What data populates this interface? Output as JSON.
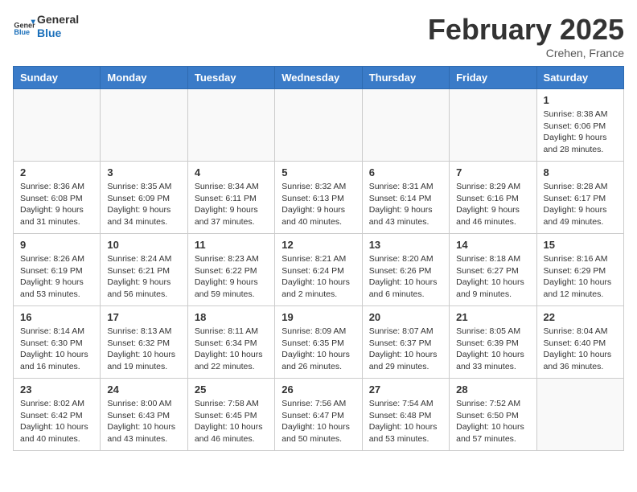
{
  "header": {
    "logo_general": "General",
    "logo_blue": "Blue",
    "month_title": "February 2025",
    "location": "Crehen, France"
  },
  "calendar": {
    "days_of_week": [
      "Sunday",
      "Monday",
      "Tuesday",
      "Wednesday",
      "Thursday",
      "Friday",
      "Saturday"
    ],
    "weeks": [
      [
        {
          "day": "",
          "info": ""
        },
        {
          "day": "",
          "info": ""
        },
        {
          "day": "",
          "info": ""
        },
        {
          "day": "",
          "info": ""
        },
        {
          "day": "",
          "info": ""
        },
        {
          "day": "",
          "info": ""
        },
        {
          "day": "1",
          "info": "Sunrise: 8:38 AM\nSunset: 6:06 PM\nDaylight: 9 hours and 28 minutes."
        }
      ],
      [
        {
          "day": "2",
          "info": "Sunrise: 8:36 AM\nSunset: 6:08 PM\nDaylight: 9 hours and 31 minutes."
        },
        {
          "day": "3",
          "info": "Sunrise: 8:35 AM\nSunset: 6:09 PM\nDaylight: 9 hours and 34 minutes."
        },
        {
          "day": "4",
          "info": "Sunrise: 8:34 AM\nSunset: 6:11 PM\nDaylight: 9 hours and 37 minutes."
        },
        {
          "day": "5",
          "info": "Sunrise: 8:32 AM\nSunset: 6:13 PM\nDaylight: 9 hours and 40 minutes."
        },
        {
          "day": "6",
          "info": "Sunrise: 8:31 AM\nSunset: 6:14 PM\nDaylight: 9 hours and 43 minutes."
        },
        {
          "day": "7",
          "info": "Sunrise: 8:29 AM\nSunset: 6:16 PM\nDaylight: 9 hours and 46 minutes."
        },
        {
          "day": "8",
          "info": "Sunrise: 8:28 AM\nSunset: 6:17 PM\nDaylight: 9 hours and 49 minutes."
        }
      ],
      [
        {
          "day": "9",
          "info": "Sunrise: 8:26 AM\nSunset: 6:19 PM\nDaylight: 9 hours and 53 minutes."
        },
        {
          "day": "10",
          "info": "Sunrise: 8:24 AM\nSunset: 6:21 PM\nDaylight: 9 hours and 56 minutes."
        },
        {
          "day": "11",
          "info": "Sunrise: 8:23 AM\nSunset: 6:22 PM\nDaylight: 9 hours and 59 minutes."
        },
        {
          "day": "12",
          "info": "Sunrise: 8:21 AM\nSunset: 6:24 PM\nDaylight: 10 hours and 2 minutes."
        },
        {
          "day": "13",
          "info": "Sunrise: 8:20 AM\nSunset: 6:26 PM\nDaylight: 10 hours and 6 minutes."
        },
        {
          "day": "14",
          "info": "Sunrise: 8:18 AM\nSunset: 6:27 PM\nDaylight: 10 hours and 9 minutes."
        },
        {
          "day": "15",
          "info": "Sunrise: 8:16 AM\nSunset: 6:29 PM\nDaylight: 10 hours and 12 minutes."
        }
      ],
      [
        {
          "day": "16",
          "info": "Sunrise: 8:14 AM\nSunset: 6:30 PM\nDaylight: 10 hours and 16 minutes."
        },
        {
          "day": "17",
          "info": "Sunrise: 8:13 AM\nSunset: 6:32 PM\nDaylight: 10 hours and 19 minutes."
        },
        {
          "day": "18",
          "info": "Sunrise: 8:11 AM\nSunset: 6:34 PM\nDaylight: 10 hours and 22 minutes."
        },
        {
          "day": "19",
          "info": "Sunrise: 8:09 AM\nSunset: 6:35 PM\nDaylight: 10 hours and 26 minutes."
        },
        {
          "day": "20",
          "info": "Sunrise: 8:07 AM\nSunset: 6:37 PM\nDaylight: 10 hours and 29 minutes."
        },
        {
          "day": "21",
          "info": "Sunrise: 8:05 AM\nSunset: 6:39 PM\nDaylight: 10 hours and 33 minutes."
        },
        {
          "day": "22",
          "info": "Sunrise: 8:04 AM\nSunset: 6:40 PM\nDaylight: 10 hours and 36 minutes."
        }
      ],
      [
        {
          "day": "23",
          "info": "Sunrise: 8:02 AM\nSunset: 6:42 PM\nDaylight: 10 hours and 40 minutes."
        },
        {
          "day": "24",
          "info": "Sunrise: 8:00 AM\nSunset: 6:43 PM\nDaylight: 10 hours and 43 minutes."
        },
        {
          "day": "25",
          "info": "Sunrise: 7:58 AM\nSunset: 6:45 PM\nDaylight: 10 hours and 46 minutes."
        },
        {
          "day": "26",
          "info": "Sunrise: 7:56 AM\nSunset: 6:47 PM\nDaylight: 10 hours and 50 minutes."
        },
        {
          "day": "27",
          "info": "Sunrise: 7:54 AM\nSunset: 6:48 PM\nDaylight: 10 hours and 53 minutes."
        },
        {
          "day": "28",
          "info": "Sunrise: 7:52 AM\nSunset: 6:50 PM\nDaylight: 10 hours and 57 minutes."
        },
        {
          "day": "",
          "info": ""
        }
      ]
    ]
  }
}
